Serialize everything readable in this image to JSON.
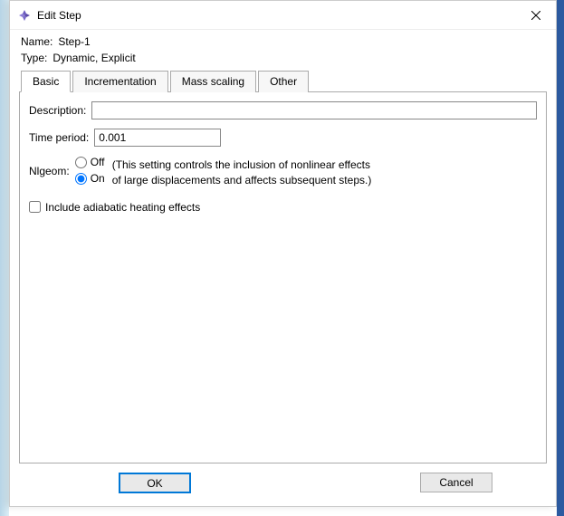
{
  "titlebar": {
    "title": "Edit Step"
  },
  "info": {
    "name_label": "Name:",
    "name_value": "Step-1",
    "type_label": "Type:",
    "type_value": "Dynamic, Explicit"
  },
  "tabs": {
    "basic": "Basic",
    "incrementation": "Incrementation",
    "mass_scaling": "Mass scaling",
    "other": "Other"
  },
  "basic": {
    "description_label": "Description:",
    "description_value": "",
    "time_period_label": "Time period:",
    "time_period_value": "0.001",
    "nlgeom_label": "Nlgeom:",
    "nlgeom_off": "Off",
    "nlgeom_on": "On",
    "nlgeom_help_line1": "(This setting controls the inclusion of nonlinear effects",
    "nlgeom_help_line2": "of large displacements and affects subsequent steps.)",
    "adiabatic_label": "Include adiabatic heating effects"
  },
  "buttons": {
    "ok": "OK",
    "cancel": "Cancel"
  }
}
